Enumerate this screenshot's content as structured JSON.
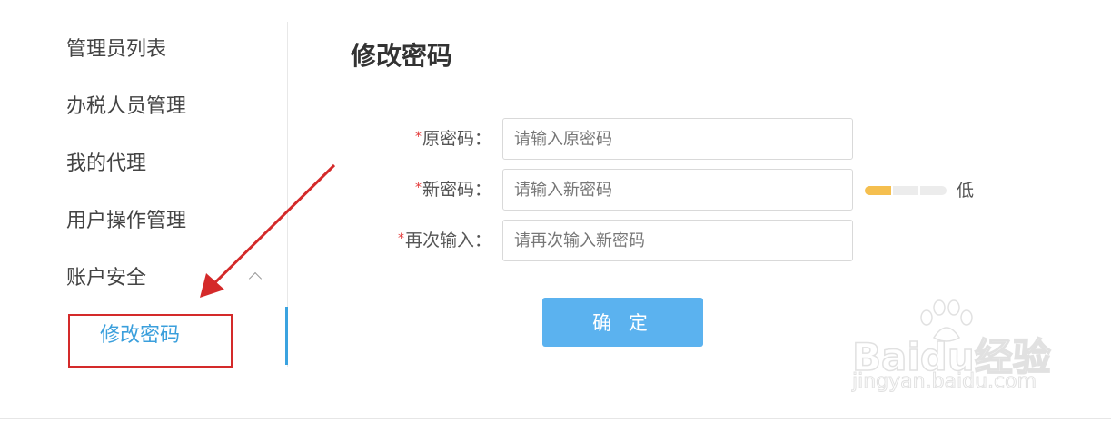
{
  "sidebar": {
    "items": [
      {
        "label": "管理员列表"
      },
      {
        "label": "办税人员管理"
      },
      {
        "label": "我的代理"
      },
      {
        "label": "用户操作管理"
      },
      {
        "label": "账户安全",
        "expanded": true,
        "icon": "chevron-up-icon"
      }
    ],
    "sub_items": [
      {
        "label": "修改密码",
        "active": true
      }
    ]
  },
  "main": {
    "title": "修改密码",
    "form": {
      "required_mark": "*",
      "old_password": {
        "label": "原密码：",
        "placeholder": "请输入原密码",
        "value": ""
      },
      "new_password": {
        "label": "新密码：",
        "placeholder": "请输入新密码",
        "value": ""
      },
      "confirm_password": {
        "label": "再次输入：",
        "placeholder": "请再次输入新密码",
        "value": ""
      },
      "strength": {
        "level_text": "低",
        "filled_segments": 1,
        "total_segments": 3
      },
      "submit_label": "确 定"
    }
  },
  "watermark": {
    "brand": "Baidu经验",
    "url": "jingyan.baidu.com"
  },
  "annotation": {
    "arrow_color": "#d42a2a",
    "box_color": "#d42a2a"
  },
  "colors": {
    "accent": "#3a9fdc",
    "button": "#5bb2ef",
    "strength_low": "#f5bf4f",
    "required": "#e23838"
  }
}
